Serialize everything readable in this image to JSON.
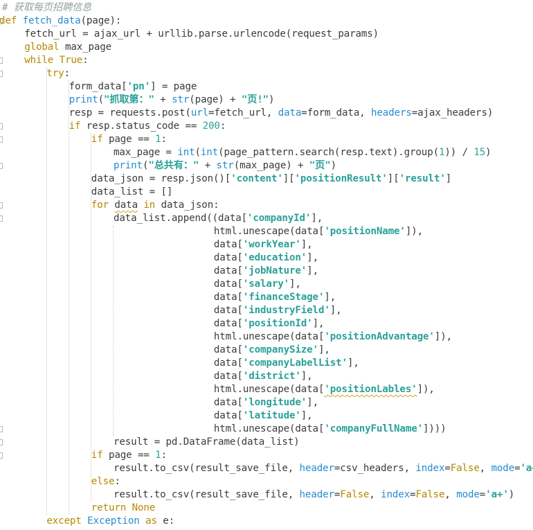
{
  "editor": {
    "colors": {
      "background": "#ffffff",
      "text": "#3b3b3b",
      "keyword": "#b58900",
      "builtin": "#268bd2",
      "string": "#2aa198",
      "comment": "#93a1a1"
    },
    "lines": [
      {
        "indent": 0,
        "tokens": [
          [
            "cm",
            "# 获取每页招聘信息"
          ]
        ]
      },
      {
        "indent": 0,
        "fold": true,
        "tokens": [
          [
            "kw",
            "def"
          ],
          [
            "",
            " "
          ],
          [
            "fn",
            "fetch_data"
          ],
          [
            "",
            "(page):"
          ]
        ]
      },
      {
        "indent": 1,
        "tokens": [
          [
            "",
            "fetch_url = ajax_url + urllib.parse.urlencode(request_params)"
          ]
        ]
      },
      {
        "indent": 1,
        "tokens": [
          [
            "kw",
            "global"
          ],
          [
            "",
            " max_page"
          ]
        ]
      },
      {
        "indent": 1,
        "fold": true,
        "tokens": [
          [
            "kw",
            "while"
          ],
          [
            "",
            " "
          ],
          [
            "kw",
            "True"
          ],
          [
            "",
            ":"
          ]
        ]
      },
      {
        "indent": 2,
        "fold": true,
        "tokens": [
          [
            "kw",
            "try"
          ],
          [
            "",
            ":"
          ]
        ]
      },
      {
        "indent": 3,
        "tokens": [
          [
            "",
            "form_data["
          ],
          [
            "str",
            "'pn'"
          ],
          [
            "",
            "] = page"
          ]
        ]
      },
      {
        "indent": 3,
        "tokens": [
          [
            "bi",
            "print"
          ],
          [
            "",
            "("
          ],
          [
            "str",
            "\"抓取第：\""
          ],
          [
            "",
            " + "
          ],
          [
            "bi",
            "str"
          ],
          [
            "",
            "(page) + "
          ],
          [
            "str",
            "\"页!\""
          ],
          [
            "",
            ")"
          ]
        ]
      },
      {
        "indent": 3,
        "tokens": [
          [
            "",
            "resp = requests.post("
          ],
          [
            "kwarg",
            "url"
          ],
          [
            "",
            "=fetch_url, "
          ],
          [
            "kwarg",
            "data"
          ],
          [
            "",
            "=form_data, "
          ],
          [
            "kwarg",
            "headers"
          ],
          [
            "",
            "=ajax_headers)"
          ]
        ]
      },
      {
        "indent": 3,
        "fold": true,
        "tokens": [
          [
            "kw",
            "if"
          ],
          [
            "",
            " resp.status_code == "
          ],
          [
            "num",
            "200"
          ],
          [
            "",
            ":"
          ]
        ]
      },
      {
        "indent": 4,
        "fold": true,
        "tokens": [
          [
            "kw",
            "if"
          ],
          [
            "",
            " page == "
          ],
          [
            "num",
            "1"
          ],
          [
            "",
            ":"
          ]
        ]
      },
      {
        "indent": 5,
        "tokens": [
          [
            "",
            "max_page = "
          ],
          [
            "bi",
            "int"
          ],
          [
            "",
            "("
          ],
          [
            "bi",
            "int"
          ],
          [
            "",
            "(page_pattern.search(resp.text).group("
          ],
          [
            "num",
            "1"
          ],
          [
            "",
            ")) / "
          ],
          [
            "num",
            "15"
          ],
          [
            "",
            ")"
          ]
        ]
      },
      {
        "indent": 5,
        "fold": true,
        "tokens": [
          [
            "bi",
            "print"
          ],
          [
            "",
            "("
          ],
          [
            "str",
            "\"总共有：\""
          ],
          [
            "",
            " + "
          ],
          [
            "bi",
            "str"
          ],
          [
            "",
            "(max_page) + "
          ],
          [
            "str",
            "\"页\""
          ],
          [
            "",
            ")"
          ]
        ]
      },
      {
        "indent": 4,
        "tokens": [
          [
            "",
            "data_json = resp.json()["
          ],
          [
            "str",
            "'content'"
          ],
          [
            "",
            "]["
          ],
          [
            "str",
            "'positionResult'"
          ],
          [
            "",
            "]["
          ],
          [
            "str",
            "'result'"
          ],
          [
            "",
            "]"
          ]
        ]
      },
      {
        "indent": 4,
        "tokens": [
          [
            "",
            "data_list = []"
          ]
        ]
      },
      {
        "indent": 4,
        "fold": true,
        "tokens": [
          [
            "kw",
            "for"
          ],
          [
            "",
            " "
          ],
          [
            "sq",
            "data"
          ],
          [
            "",
            " "
          ],
          [
            "kw",
            "in"
          ],
          [
            "",
            " data_json:"
          ]
        ]
      },
      {
        "indent": 5,
        "fold": true,
        "tokens": [
          [
            "",
            "data_list.append((data["
          ],
          [
            "str",
            "'companyId'"
          ],
          [
            "",
            "],"
          ]
        ]
      },
      {
        "indent": 9.5,
        "tokens": [
          [
            "",
            "html.unescape(data["
          ],
          [
            "str",
            "'positionName'"
          ],
          [
            "",
            "]),"
          ]
        ]
      },
      {
        "indent": 9.5,
        "tokens": [
          [
            "",
            "data["
          ],
          [
            "str",
            "'workYear'"
          ],
          [
            "",
            "],"
          ]
        ]
      },
      {
        "indent": 9.5,
        "tokens": [
          [
            "",
            "data["
          ],
          [
            "str",
            "'education'"
          ],
          [
            "",
            "],"
          ]
        ]
      },
      {
        "indent": 9.5,
        "tokens": [
          [
            "",
            "data["
          ],
          [
            "str",
            "'jobNature'"
          ],
          [
            "",
            "],"
          ]
        ]
      },
      {
        "indent": 9.5,
        "tokens": [
          [
            "",
            "data["
          ],
          [
            "str",
            "'salary'"
          ],
          [
            "",
            "],"
          ]
        ]
      },
      {
        "indent": 9.5,
        "tokens": [
          [
            "",
            "data["
          ],
          [
            "str",
            "'financeStage'"
          ],
          [
            "",
            "],"
          ]
        ]
      },
      {
        "indent": 9.5,
        "tokens": [
          [
            "",
            "data["
          ],
          [
            "str",
            "'industryField'"
          ],
          [
            "",
            "],"
          ]
        ]
      },
      {
        "indent": 9.5,
        "tokens": [
          [
            "",
            "data["
          ],
          [
            "str",
            "'positionId'"
          ],
          [
            "",
            "],"
          ]
        ]
      },
      {
        "indent": 9.5,
        "tokens": [
          [
            "",
            "html.unescape(data["
          ],
          [
            "str",
            "'positionAdvantage'"
          ],
          [
            "",
            "]),"
          ]
        ]
      },
      {
        "indent": 9.5,
        "tokens": [
          [
            "",
            "data["
          ],
          [
            "str",
            "'companySize'"
          ],
          [
            "",
            "],"
          ]
        ]
      },
      {
        "indent": 9.5,
        "tokens": [
          [
            "",
            "data["
          ],
          [
            "str",
            "'companyLabelList'"
          ],
          [
            "",
            "],"
          ]
        ]
      },
      {
        "indent": 9.5,
        "tokens": [
          [
            "",
            "data["
          ],
          [
            "str",
            "'district'"
          ],
          [
            "",
            "],"
          ]
        ]
      },
      {
        "indent": 9.5,
        "tokens": [
          [
            "",
            "html.unescape(data["
          ],
          [
            "strsq",
            "'positionLables'"
          ],
          [
            "",
            "]),"
          ]
        ]
      },
      {
        "indent": 9.5,
        "tokens": [
          [
            "",
            "data["
          ],
          [
            "str",
            "'longitude'"
          ],
          [
            "",
            "],"
          ]
        ]
      },
      {
        "indent": 9.5,
        "tokens": [
          [
            "",
            "data["
          ],
          [
            "str",
            "'latitude'"
          ],
          [
            "",
            "],"
          ]
        ]
      },
      {
        "indent": 9.5,
        "fold": true,
        "tokens": [
          [
            "",
            "html.unescape(data["
          ],
          [
            "str",
            "'companyFullName'"
          ],
          [
            "",
            "])))"
          ]
        ]
      },
      {
        "indent": 5,
        "fold": true,
        "tokens": [
          [
            "",
            "result = pd.DataFrame(data_list)"
          ]
        ]
      },
      {
        "indent": 4,
        "fold": true,
        "tokens": [
          [
            "kw",
            "if"
          ],
          [
            "",
            " page == "
          ],
          [
            "num",
            "1"
          ],
          [
            "",
            ":"
          ]
        ]
      },
      {
        "indent": 5,
        "tokens": [
          [
            "",
            "result.to_csv(result_save_file, "
          ],
          [
            "kwarg",
            "header"
          ],
          [
            "",
            "=csv_headers, "
          ],
          [
            "kwarg",
            "index"
          ],
          [
            "",
            "="
          ],
          [
            "kw",
            "False"
          ],
          [
            "",
            ", "
          ],
          [
            "kwarg",
            "mode"
          ],
          [
            "",
            "="
          ],
          [
            "str",
            "'a+'"
          ],
          [
            "",
            ")"
          ]
        ]
      },
      {
        "indent": 4,
        "tokens": [
          [
            "kw",
            "else"
          ],
          [
            "",
            ":"
          ]
        ]
      },
      {
        "indent": 5,
        "tokens": [
          [
            "",
            "result.to_csv(result_save_file, "
          ],
          [
            "kwarg",
            "header"
          ],
          [
            "",
            "="
          ],
          [
            "kw",
            "False"
          ],
          [
            "",
            ", "
          ],
          [
            "kwarg",
            "index"
          ],
          [
            "",
            "="
          ],
          [
            "kw",
            "False"
          ],
          [
            "",
            ", "
          ],
          [
            "kwarg",
            "mode"
          ],
          [
            "",
            "="
          ],
          [
            "str",
            "'a+'"
          ],
          [
            "",
            ")"
          ]
        ]
      },
      {
        "indent": 4,
        "tokens": [
          [
            "kw",
            "return"
          ],
          [
            "",
            " "
          ],
          [
            "kw",
            "None"
          ]
        ]
      },
      {
        "indent": 2,
        "tokens": [
          [
            "kw",
            "except"
          ],
          [
            "",
            " "
          ],
          [
            "bi",
            "Exception"
          ],
          [
            "",
            " "
          ],
          [
            "kw",
            "as"
          ],
          [
            "",
            " e:"
          ]
        ]
      }
    ]
  }
}
